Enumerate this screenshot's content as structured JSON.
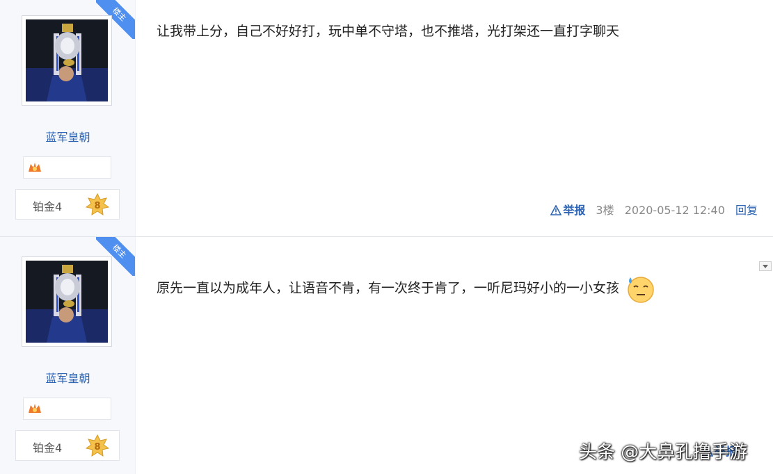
{
  "posts": [
    {
      "badge": "楼主",
      "username": "蓝军皇朝",
      "rank": "铂金4",
      "rank_level": "8",
      "content": "让我带上分，自己不好好打，玩中单不守塔，也不推塔，光打架还一直打字聊天",
      "report_label": "举报",
      "floor": "3楼",
      "timestamp": "2020-05-12 12:40",
      "reply_label": "回复"
    },
    {
      "badge": "楼主",
      "username": "蓝军皇朝",
      "rank": "铂金4",
      "rank_level": "8",
      "content": "原先一直以为成年人，让语音不肯，有一次终于肯了，一听尼玛好小的一小女孩",
      "report_label": "举报",
      "floor": "",
      "timestamp": "",
      "reply_label": ""
    }
  ],
  "watermark": "头条 @大鼻孔撸手游",
  "colors": {
    "accent": "#2d64b3",
    "ribbon": "#4e8ff0",
    "sidebar": "#f7f8fb"
  }
}
